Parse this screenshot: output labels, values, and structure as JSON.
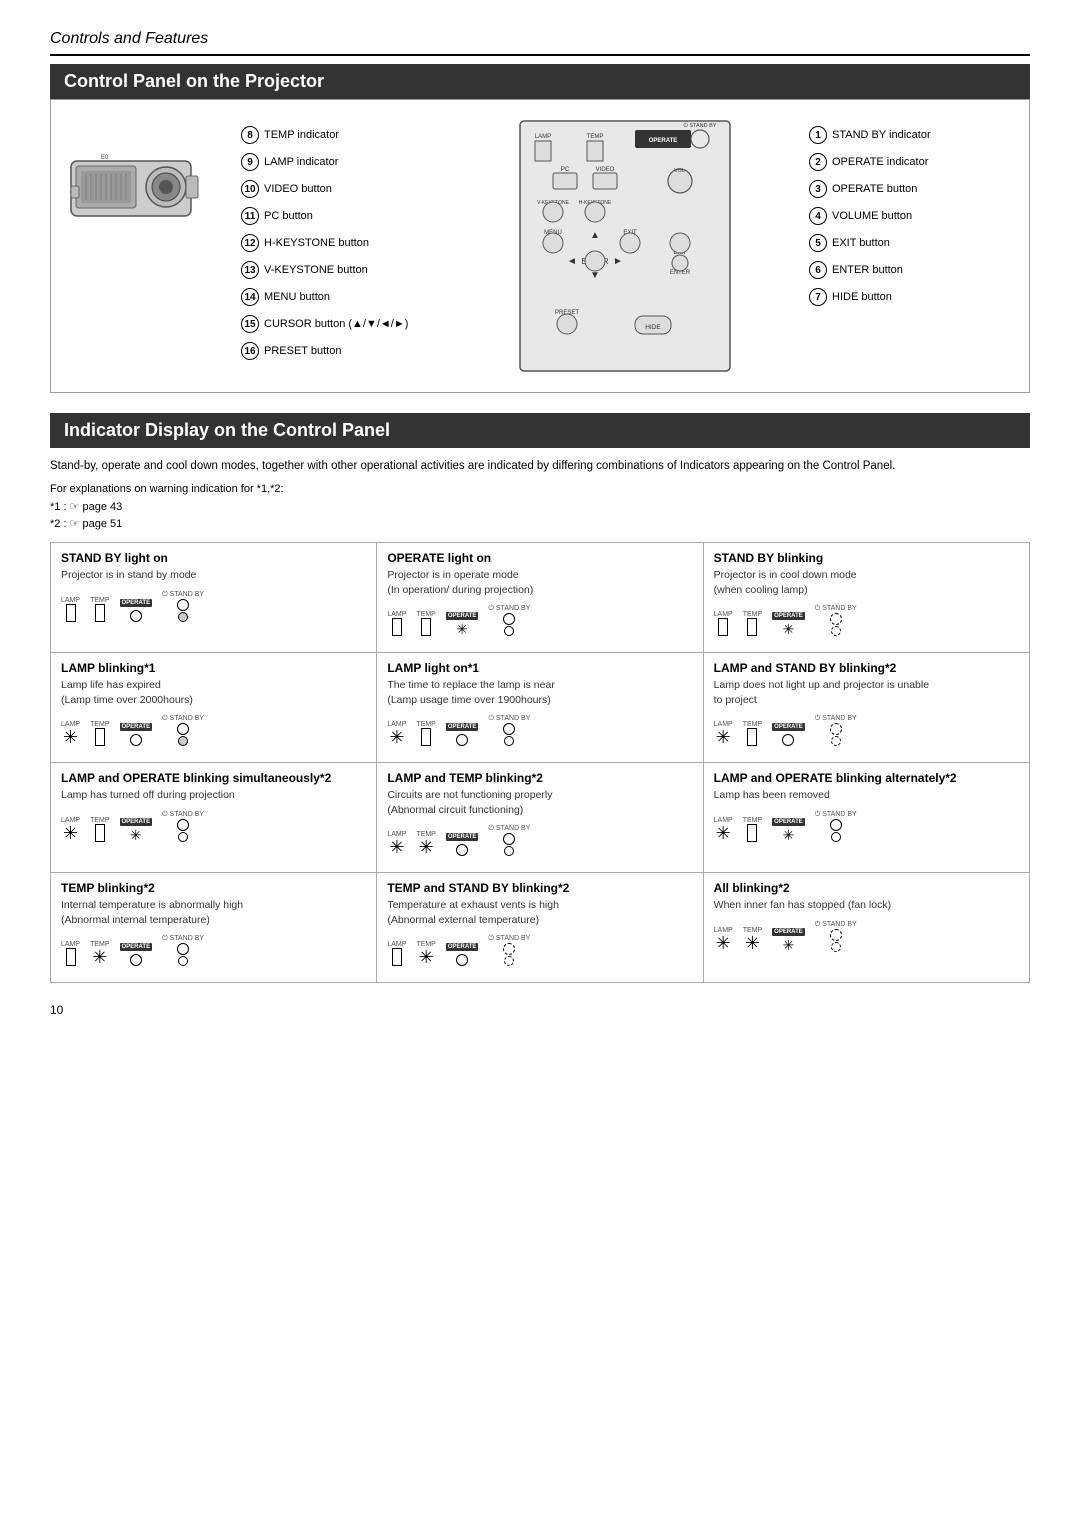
{
  "page": {
    "section_title": "Controls and Features",
    "panel_section_header": "Control Panel on the Projector",
    "indicator_section_header": "Indicator Display on the Control Panel",
    "indicator_intro": "Stand-by, operate and cool down modes, together with other operational activities are indicated by differing combinations of Indicators appearing on the Control Panel.",
    "indicator_for_explanation": "For explanations on warning indication for *1,*2:",
    "note1": "*1 : ☞ page 43",
    "note2": "*2 : ☞ page 51",
    "left_labels": [
      {
        "num": "8",
        "text": "TEMP indicator"
      },
      {
        "num": "9",
        "text": "LAMP indicator"
      },
      {
        "num": "10",
        "text": "VIDEO button"
      },
      {
        "num": "11",
        "text": "PC button"
      },
      {
        "num": "12",
        "text": "H-KEYSTONE button"
      },
      {
        "num": "13",
        "text": "V-KEYSTONE button"
      },
      {
        "num": "14",
        "text": "MENU button"
      },
      {
        "num": "15",
        "text": "CURSOR button (▲/▼/◄/►)"
      },
      {
        "num": "16",
        "text": "PRESET button"
      }
    ],
    "right_labels": [
      {
        "num": "1",
        "text": "STAND BY indicator"
      },
      {
        "num": "2",
        "text": "OPERATE indicator"
      },
      {
        "num": "3",
        "text": "OPERATE button"
      },
      {
        "num": "4",
        "text": "VOLUME button"
      },
      {
        "num": "5",
        "text": "EXIT button"
      },
      {
        "num": "6",
        "text": "ENTER button"
      },
      {
        "num": "7",
        "text": "HIDE button"
      }
    ],
    "indicator_cells": [
      {
        "title": "STAND BY light on",
        "desc": "Projector is in stand by mode",
        "standby": "on",
        "lamp": "off",
        "temp": "off",
        "operate": "off"
      },
      {
        "title": "OPERATE light on",
        "desc": "Projector is in operate mode\n(In operation/ during projection)",
        "standby": "off",
        "lamp": "off",
        "temp": "off",
        "operate": "on"
      },
      {
        "title": "STAND BY blinking",
        "desc": "Projector is in cool down mode\n(when cooling lamp)",
        "standby": "blink",
        "lamp": "off",
        "temp": "off",
        "operate": "on"
      },
      {
        "title": "LAMP blinking*1",
        "desc": "Lamp life has expired\n(Lamp time over 2000hours)",
        "standby": "on",
        "lamp": "blink",
        "temp": "off",
        "operate": "off"
      },
      {
        "title": "LAMP light on*1",
        "desc": "The time to replace the lamp is near\n(Lamp usage time over 1900hours)",
        "standby": "off",
        "lamp": "on",
        "temp": "off",
        "operate": "off"
      },
      {
        "title": "LAMP and STAND BY blinking*2",
        "desc": "Lamp does not light up and projector is unable\nto project",
        "standby": "blink",
        "lamp": "blink",
        "temp": "off",
        "operate": "off"
      },
      {
        "title": "LAMP and OPERATE blinking simultaneously*2",
        "desc": "Lamp has turned off during projection",
        "standby": "off",
        "lamp": "blink",
        "temp": "off",
        "operate": "blink"
      },
      {
        "title": "LAMP and TEMP blinking*2",
        "desc": "Circuits are not functioning properly\n(Abnormal circuit functioning)",
        "standby": "off",
        "lamp": "blink",
        "temp": "blink",
        "operate": "off"
      },
      {
        "title": "LAMP and OPERATE blinking alternately*2",
        "desc": "Lamp has been removed",
        "standby": "off",
        "lamp": "blink",
        "temp": "off",
        "operate": "blink_alt"
      },
      {
        "title": "TEMP blinking*2",
        "desc": "Internal temperature is abnormally high\n(Abnormal internal temperature)",
        "standby": "off",
        "lamp": "off",
        "temp": "blink",
        "operate": "off"
      },
      {
        "title": "TEMP and STAND BY blinking*2",
        "desc": "Temperature at exhaust vents is high\n(Abnormal external temperature)",
        "standby": "blink",
        "lamp": "off",
        "temp": "blink",
        "operate": "off"
      },
      {
        "title": "All blinking*2",
        "desc": "When inner fan has stopped (fan lock)",
        "standby": "blink",
        "lamp": "blink",
        "temp": "blink",
        "operate": "blink"
      }
    ],
    "page_number": "10"
  }
}
